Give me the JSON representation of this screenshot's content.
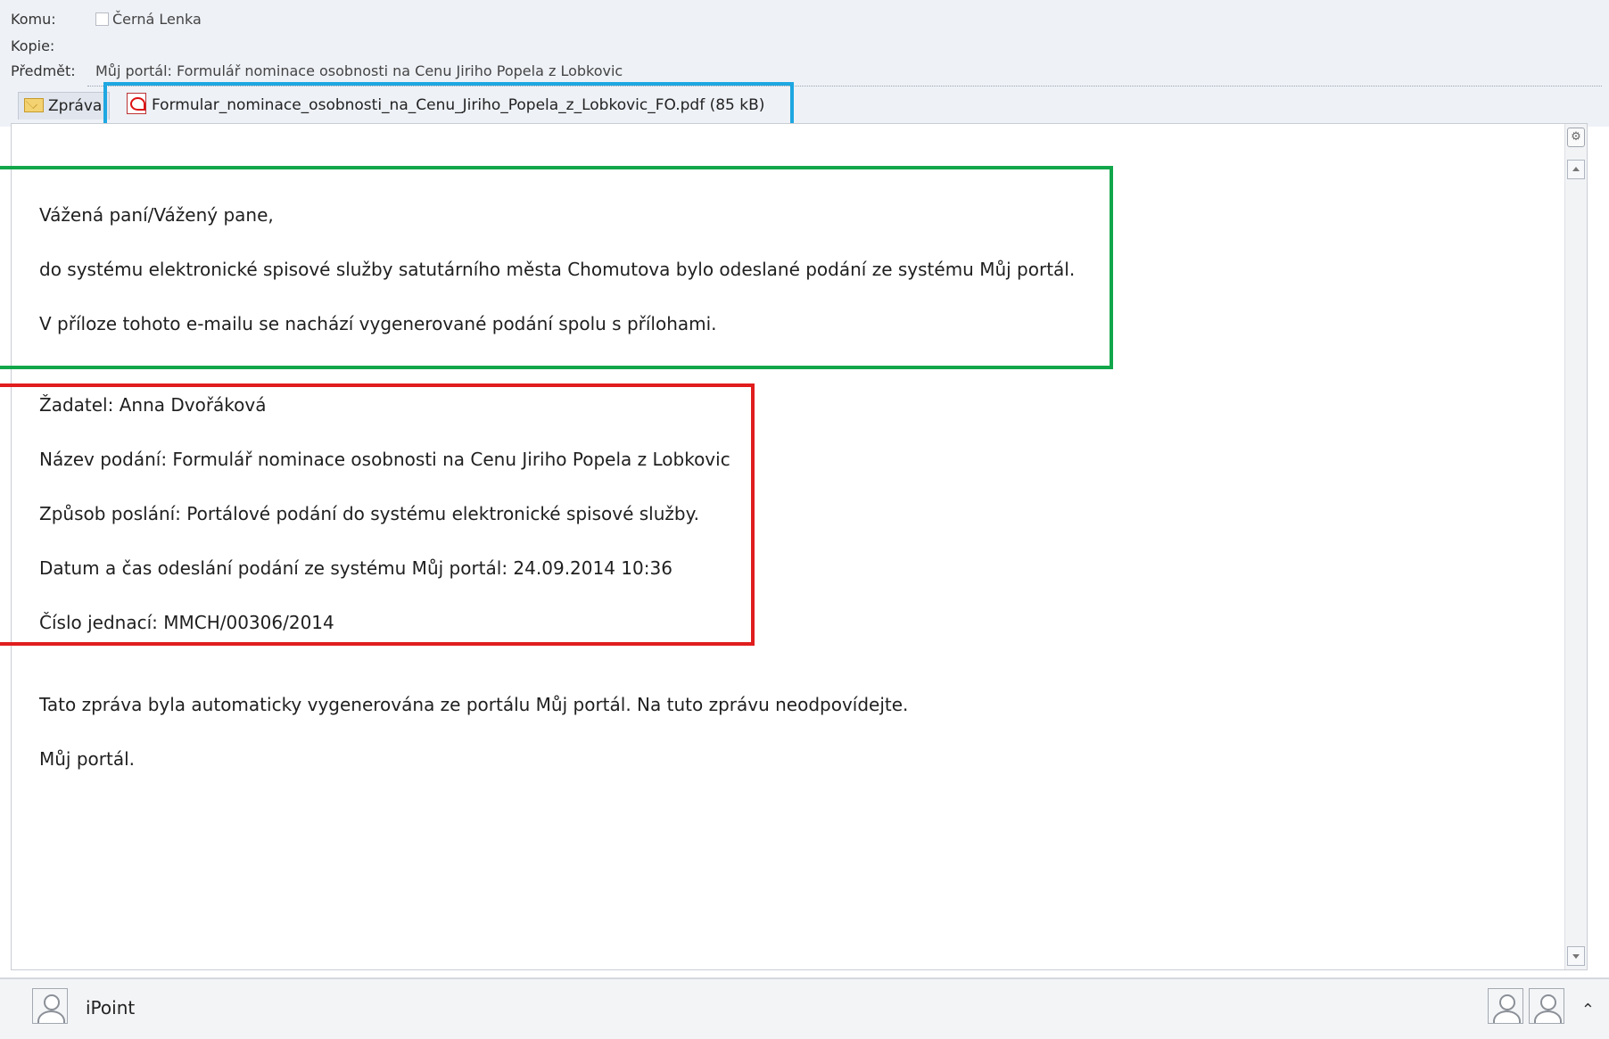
{
  "header": {
    "to_label": "Komu:",
    "to_value": "Černá Lenka",
    "cc_label": "Kopie:",
    "cc_value": "",
    "subject_label": "Předmět:",
    "subject_value": "Můj portál: Formulář nominace osobnosti na Cenu Jiriho Popela z Lobkovic"
  },
  "tabs": {
    "message_label": "Zpráva",
    "attachment_label": "Formular_nominace_osobnosti_na_Cenu_Jiriho_Popela_z_Lobkovic_FO.pdf (85 kB)"
  },
  "message": {
    "greeting": "Vážená paní/Vážený pane,",
    "line1": "do systému elektronické spisové služby satutárního města Chomutova bylo odeslané podání ze systému Můj portál.",
    "line2": "V příloze tohoto e-mailu se nachází vygenerované podání spolu s přílohami.",
    "applicant": "Žadatel: Anna Dvořáková",
    "filing_name": "Název podání: Formulář nominace osobnosti na Cenu Jiriho Popela z Lobkovic",
    "send_method": "Způsob poslání: Portálové podání do systému elektronické spisové služby.",
    "send_datetime": "Datum a čas odeslání podání ze systému Můj portál: 24.09.2014 10:36",
    "reference_number": "Číslo jednací: MMCH/00306/2014",
    "auto_note": "Tato zpráva byla automaticky vygenerována ze portálu Můj portál. Na tuto zprávu neodpovídejte.",
    "signature": "Můj portál."
  },
  "footer": {
    "contact_name": "iPoint"
  },
  "colors": {
    "highlight_blue": "#1ea7e1",
    "highlight_green": "#12a64a",
    "highlight_red": "#e11d1d"
  },
  "icons": [
    "envelope-icon",
    "pdf-icon",
    "scroll-settings-icon",
    "scroll-up-icon",
    "scroll-down-icon",
    "avatar-icon",
    "chevron-up-icon"
  ]
}
